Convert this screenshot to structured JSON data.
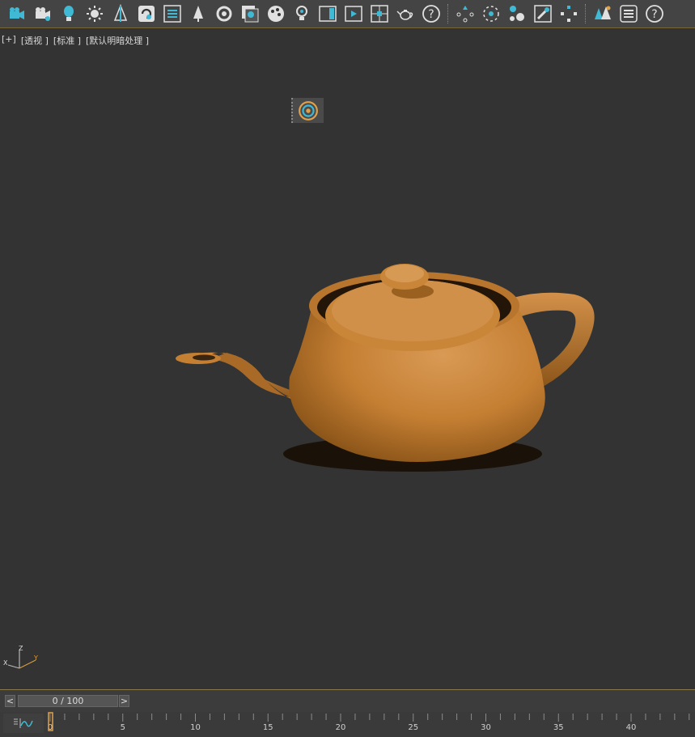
{
  "toolbar": {
    "groups": [
      [
        "camera-icon",
        "camera-target-icon",
        "light-icon",
        "sun-light-icon",
        "tree-icon",
        "refresh-icon",
        "list-icon",
        "foliage-icon",
        "spin-icon",
        "layers-icon",
        "palette-icon",
        "bulb-icon",
        "panel-icon",
        "render-frame-icon",
        "viewport-icon",
        "teapot-icon",
        "help-icon"
      ],
      [
        "points-icon",
        "dotted-circle-icon",
        "move-objects-icon",
        "paint-icon",
        "transform-icon"
      ],
      [
        "trees-icon",
        "menu-icon",
        "help-icon"
      ]
    ]
  },
  "viewport": {
    "labels": [
      "[+]",
      "[透视 ]",
      "[标准 ]",
      "[默认明暗处理 ]"
    ],
    "axis": {
      "x": "X",
      "y": "Y",
      "z": "Z"
    },
    "teapot_color": "#c57f33"
  },
  "timeline": {
    "prev": "<",
    "next": ">",
    "slider_text": "0 / 100",
    "current_frame": 0,
    "visible_max": 44,
    "labels": [
      0,
      5,
      10,
      15,
      20,
      25,
      30,
      35,
      40
    ]
  },
  "colors": {
    "accent": "#3fb9d4",
    "orange": "#e0a14a",
    "viewport_bg": "#333333"
  }
}
